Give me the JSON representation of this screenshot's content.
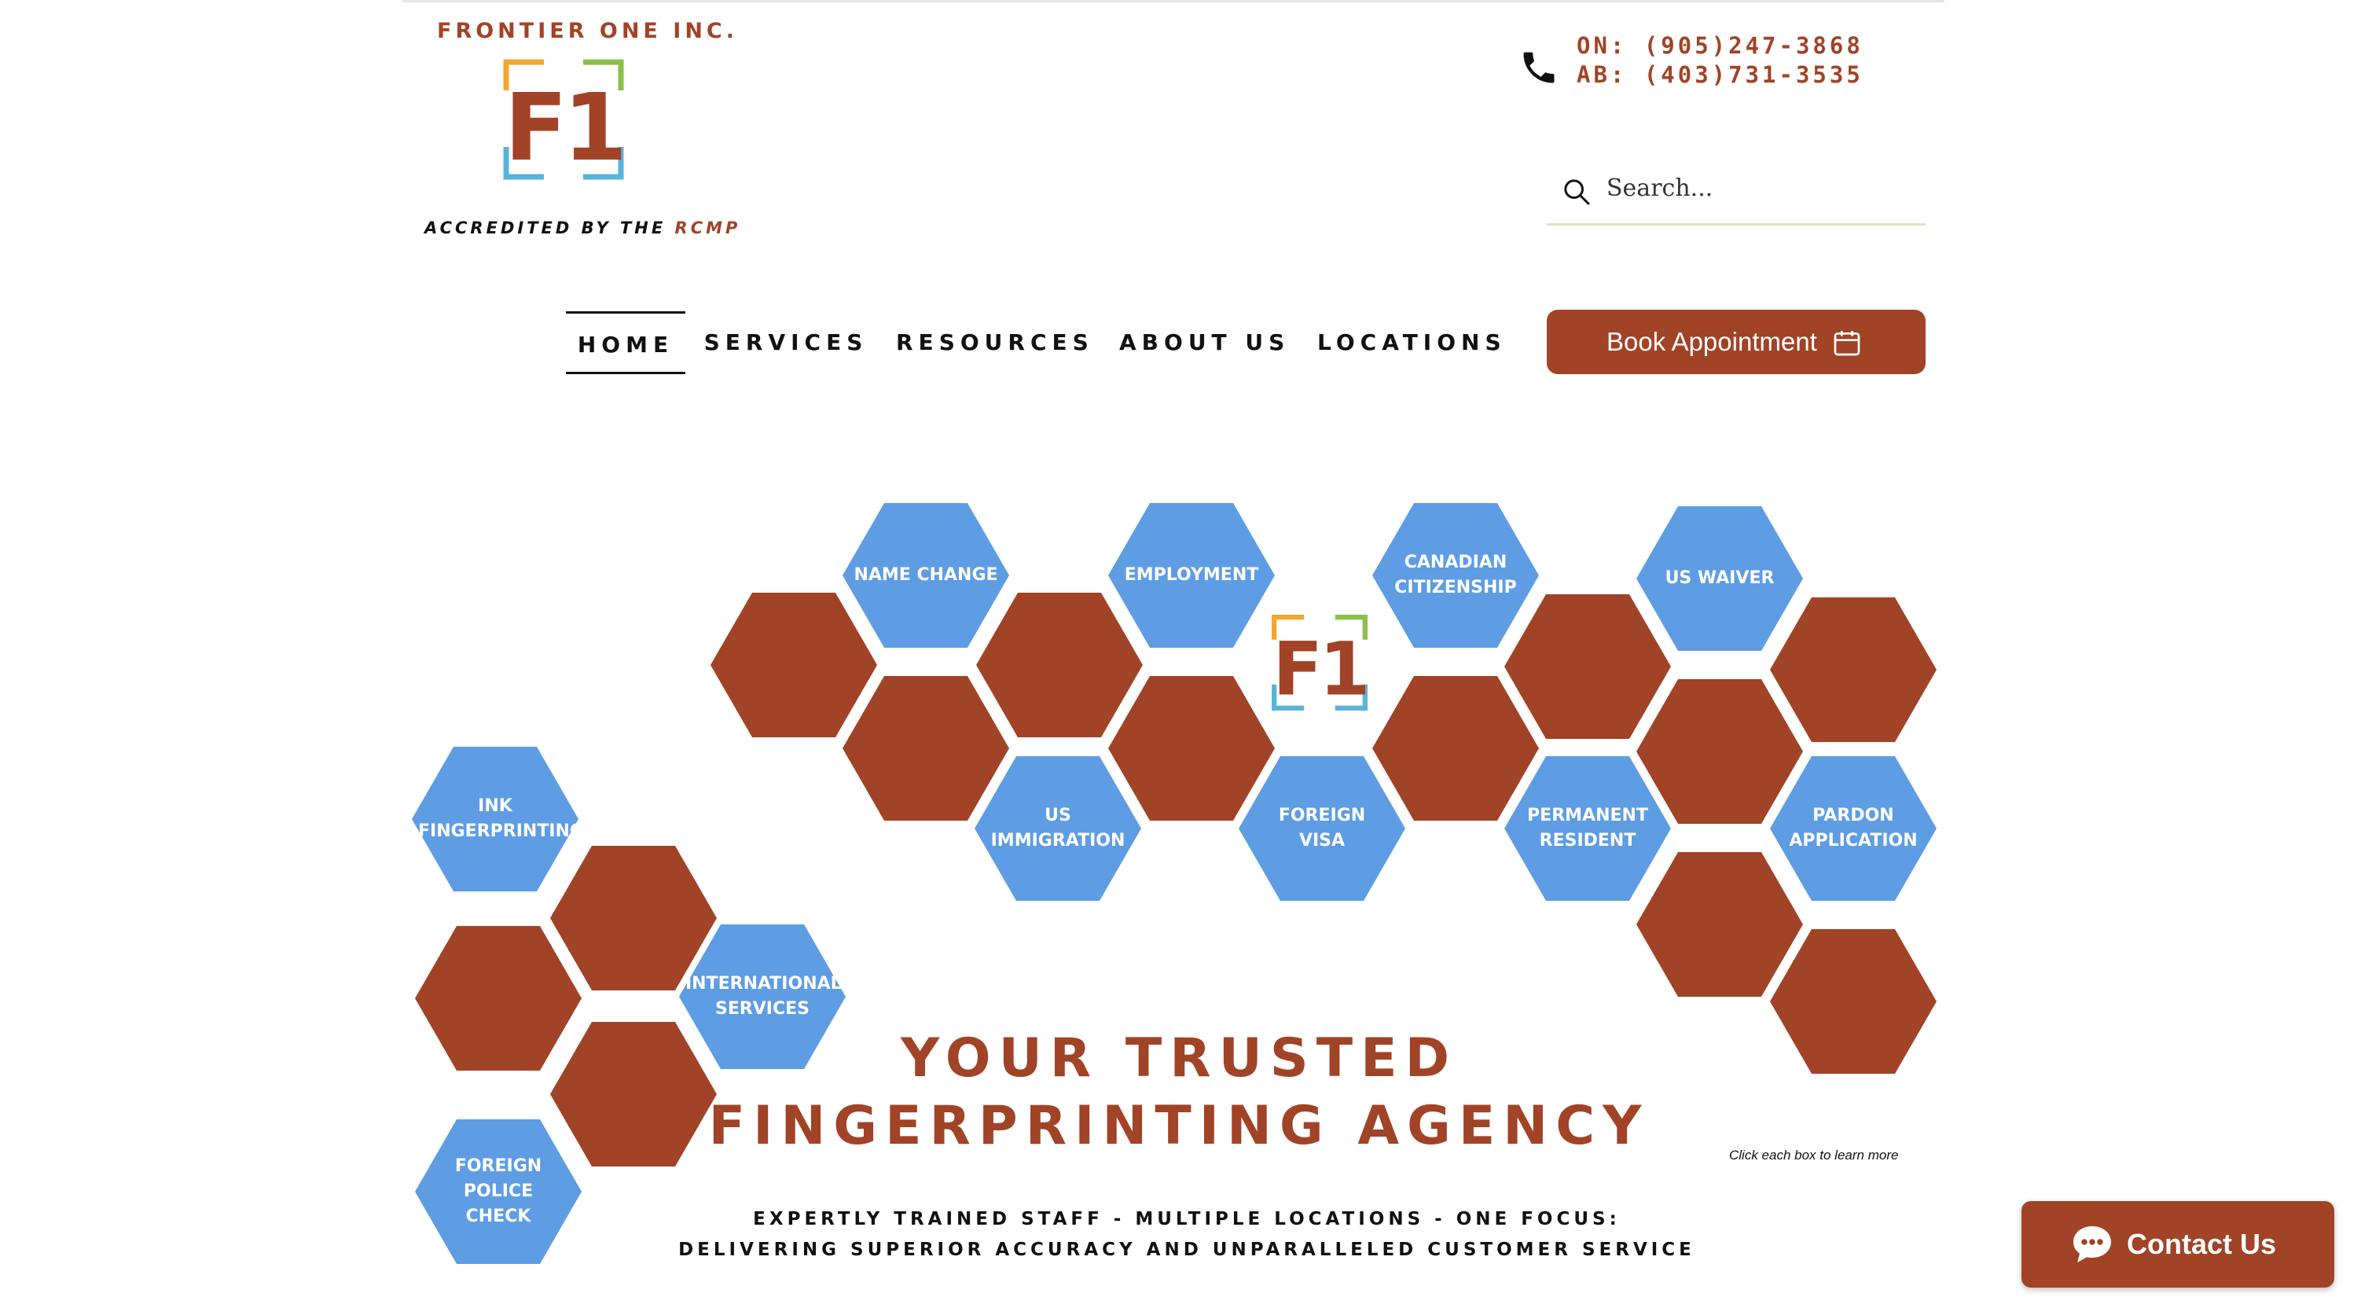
{
  "header": {
    "brand_name": "FRONTIER ONE INC.",
    "logo_text": "F1",
    "accredited_prefix": "ACCREDITED BY THE ",
    "accredited_org": "RCMP",
    "phone_on": "ON: (905)247-3868",
    "phone_ab": "AB: (403)731-3535",
    "search_placeholder": "Search..."
  },
  "nav": {
    "items": [
      {
        "label": "HOME",
        "active": true
      },
      {
        "label": "SERVICES"
      },
      {
        "label": "RESOURCES"
      },
      {
        "label": "ABOUT US"
      },
      {
        "label": "LOCATIONS"
      }
    ],
    "book_label": "Book Appointment"
  },
  "hexagons": [
    {
      "label": "NAME CHANGE"
    },
    {
      "label": "EMPLOYMENT"
    },
    {
      "label": "CANADIAN\nCITIZENSHIP"
    },
    {
      "label": "US WAIVER"
    },
    {
      "label": "US\nIMMIGRATION"
    },
    {
      "label": "FOREIGN\nVISA"
    },
    {
      "label": "PERMANENT\nRESIDENT"
    },
    {
      "label": "PARDON\nAPPLICATION"
    },
    {
      "label": "INK\nFINGERPRINTING"
    },
    {
      "label": "INTERNATIONAL\nSERVICES"
    },
    {
      "label": "FOREIGN\nPOLICE\nCHECK"
    }
  ],
  "hero": {
    "headline_1": "YOUR TRUSTED",
    "headline_2": "FINGERPRINTING AGENCY",
    "click_note": "Click each box to learn more",
    "tagline_1": "EXPERTLY TRAINED STAFF - MULTIPLE LOCATIONS - ONE FOCUS:",
    "tagline_2": "DELIVERING SUPERIOR ACCURACY AND UNPARALLELED CUSTOMER SERVICE"
  },
  "contact_label": "Contact Us",
  "colors": {
    "brand_rust": "#a14326",
    "hex_blue": "#5e9de3",
    "logo_orange": "#f0a830",
    "logo_green": "#8cc04b",
    "logo_blue": "#5ab4d8"
  },
  "icons": {
    "phone": "phone-icon",
    "search": "search-icon",
    "calendar": "calendar-icon",
    "chat": "chat-icon"
  }
}
